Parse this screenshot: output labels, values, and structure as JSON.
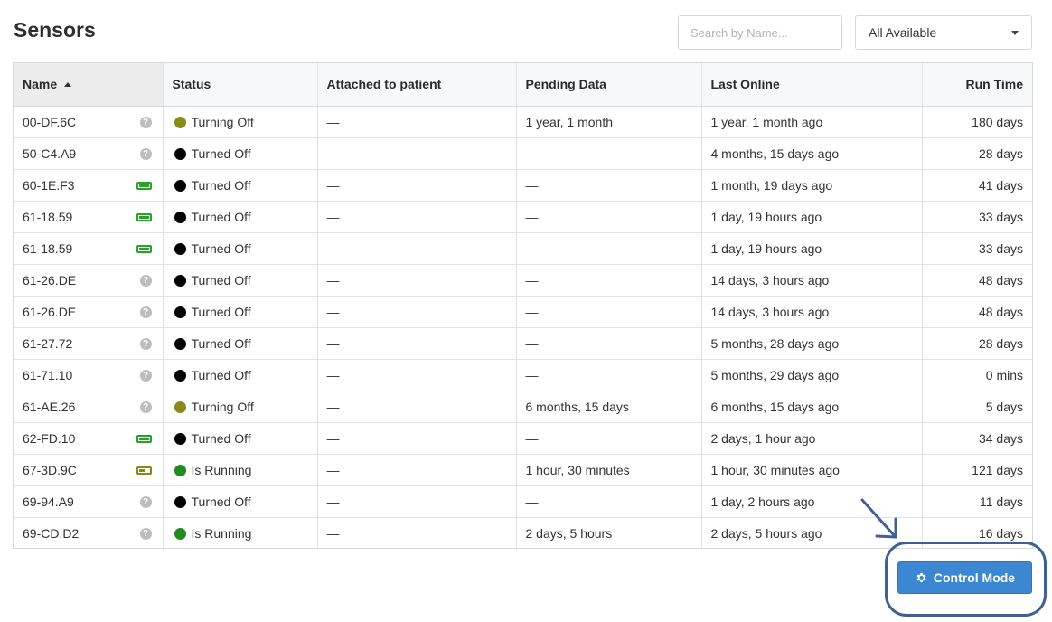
{
  "page": {
    "title": "Sensors"
  },
  "search": {
    "placeholder": "Search by Name..."
  },
  "filter": {
    "selected": "All Available"
  },
  "table": {
    "columns": [
      "Name",
      "Status",
      "Attached to patient",
      "Pending Data",
      "Last Online",
      "Run Time"
    ],
    "sorted_column": "Name",
    "sort_direction": "ascending",
    "rows": [
      {
        "name": "00-DF.6C",
        "icon": "help-icon",
        "status": "Turning Off",
        "status_color": "#8a8a1c",
        "patient": "—",
        "pending": "1 year, 1 month",
        "last_online": "1 year, 1 month ago",
        "run_time": "180 days"
      },
      {
        "name": "50-C4.A9",
        "icon": "help-icon",
        "status": "Turned Off",
        "status_color": "#000000",
        "patient": "—",
        "pending": "—",
        "last_online": "4 months, 15 days ago",
        "run_time": "28 days"
      },
      {
        "name": "60-1E.F3",
        "icon": "battery-full-icon",
        "status": "Turned Off",
        "status_color": "#000000",
        "patient": "—",
        "pending": "—",
        "last_online": "1 month, 19 days ago",
        "run_time": "41 days"
      },
      {
        "name": "61-18.59",
        "icon": "battery-full-icon",
        "status": "Turned Off",
        "status_color": "#000000",
        "patient": "—",
        "pending": "—",
        "last_online": "1 day, 19 hours ago",
        "run_time": "33 days"
      },
      {
        "name": "61-18.59",
        "icon": "battery-full-icon",
        "status": "Turned Off",
        "status_color": "#000000",
        "patient": "—",
        "pending": "—",
        "last_online": "1 day, 19 hours ago",
        "run_time": "33 days"
      },
      {
        "name": "61-26.DE",
        "icon": "help-icon",
        "status": "Turned Off",
        "status_color": "#000000",
        "patient": "—",
        "pending": "—",
        "last_online": "14 days, 3 hours ago",
        "run_time": "48 days"
      },
      {
        "name": "61-26.DE",
        "icon": "help-icon",
        "status": "Turned Off",
        "status_color": "#000000",
        "patient": "—",
        "pending": "—",
        "last_online": "14 days, 3 hours ago",
        "run_time": "48 days"
      },
      {
        "name": "61-27.72",
        "icon": "help-icon",
        "status": "Turned Off",
        "status_color": "#000000",
        "patient": "—",
        "pending": "—",
        "last_online": "5 months, 28 days ago",
        "run_time": "28 days"
      },
      {
        "name": "61-71.10",
        "icon": "help-icon",
        "status": "Turned Off",
        "status_color": "#000000",
        "patient": "—",
        "pending": "—",
        "last_online": "5 months, 29 days ago",
        "run_time": "0 mins"
      },
      {
        "name": "61-AE.26",
        "icon": "help-icon",
        "status": "Turning Off",
        "status_color": "#8a8a1c",
        "patient": "—",
        "pending": "6 months, 15 days",
        "last_online": "6 months, 15 days ago",
        "run_time": "5 days"
      },
      {
        "name": "62-FD.10",
        "icon": "battery-full-icon",
        "status": "Turned Off",
        "status_color": "#000000",
        "patient": "—",
        "pending": "—",
        "last_online": "2 days, 1 hour ago",
        "run_time": "34 days"
      },
      {
        "name": "67-3D.9C",
        "icon": "battery-partial-icon",
        "status": "Is Running",
        "status_color": "#218a21",
        "patient": "—",
        "pending": "1 hour, 30 minutes",
        "last_online": "1 hour, 30 minutes ago",
        "run_time": "121 days"
      },
      {
        "name": "69-94.A9",
        "icon": "help-icon",
        "status": "Turned Off",
        "status_color": "#000000",
        "patient": "—",
        "pending": "—",
        "last_online": "1 day, 2 hours ago",
        "run_time": "11 days"
      },
      {
        "name": "69-CD.D2",
        "icon": "help-icon",
        "status": "Is Running",
        "status_color": "#218a21",
        "patient": "—",
        "pending": "2 days, 5 hours",
        "last_online": "2 days, 5 hours ago",
        "run_time": "16 days"
      }
    ]
  },
  "control_button": {
    "label": "Control Mode",
    "icon": "gear-icon",
    "color": "#3c87d2"
  },
  "annotation": {
    "color": "#3f5f95"
  }
}
